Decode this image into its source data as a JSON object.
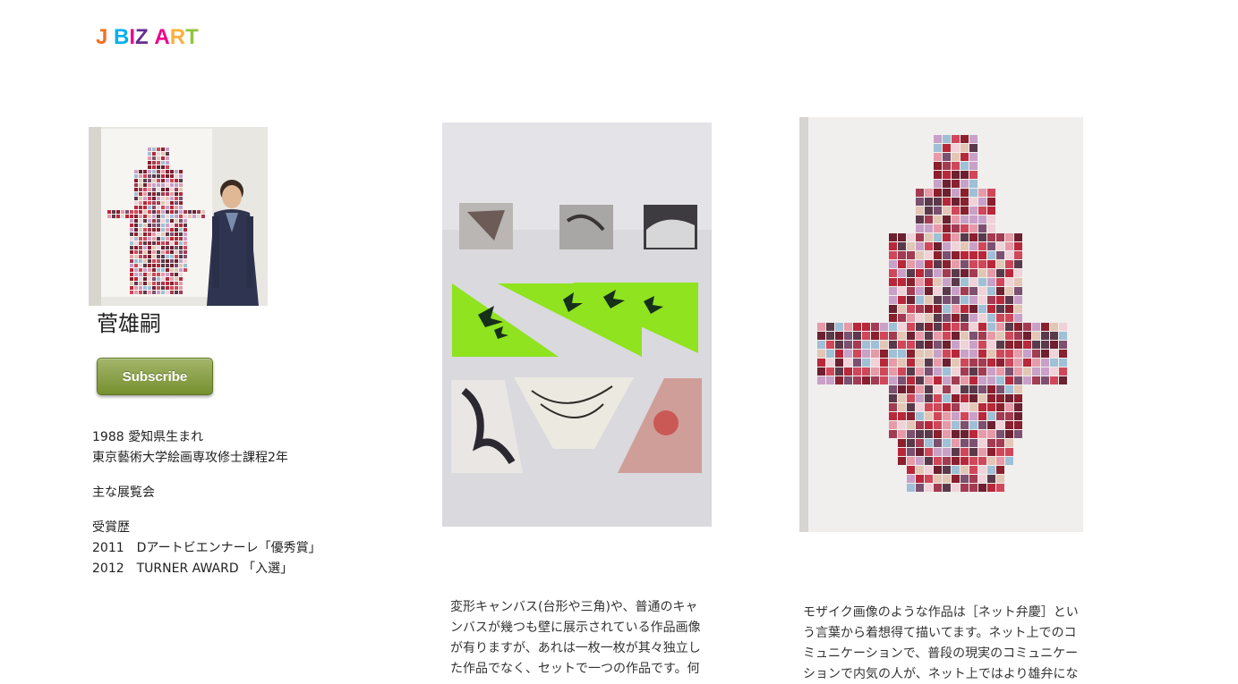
{
  "header": {
    "logo": [
      {
        "char": "J",
        "color": "#f37021"
      },
      {
        "char": " ",
        "color": "#000000"
      },
      {
        "char": "B",
        "color": "#00aeef"
      },
      {
        "char": "I",
        "color": "#ec008c"
      },
      {
        "char": "Z",
        "color": "#662d91"
      },
      {
        "char": " ",
        "color": "#000000"
      },
      {
        "char": "A",
        "color": "#ec008c"
      },
      {
        "char": "R",
        "color": "#fbb040"
      },
      {
        "char": "T",
        "color": "#8dc63f"
      }
    ]
  },
  "profile": {
    "name": "菅雄嗣",
    "subscribe_label": "Subscribe",
    "bio_lines": [
      "1988 愛知県生まれ",
      "東京藝術大学絵画専攻修士課程2年"
    ],
    "exhibitions_heading": "主な展覧会",
    "awards_heading": "受賞歴",
    "awards": [
      "2011　Dアートビエンナーレ「優秀賞」",
      "2012　TURNER AWARD 「入選」"
    ]
  },
  "gallery": {
    "caption_1": "変形キャンバス(台形や三角)や、普通のキャンバスが幾つも壁に展示されている作品画像が有りますが、あれは一枚一枚が其々独立した作品でなく、セットで一つの作品です。何",
    "caption_2": "モザイク画像のような作品は［ネット弁慶］という言葉から着想得て描いてます。ネット上でのコミュニケーションで、普段の現実のコミュニケーションで内気の人が、ネット上ではより雄弁にな"
  },
  "colors": {
    "subscribe_green": "#87a040",
    "canvas_green": "#8fe31f"
  }
}
